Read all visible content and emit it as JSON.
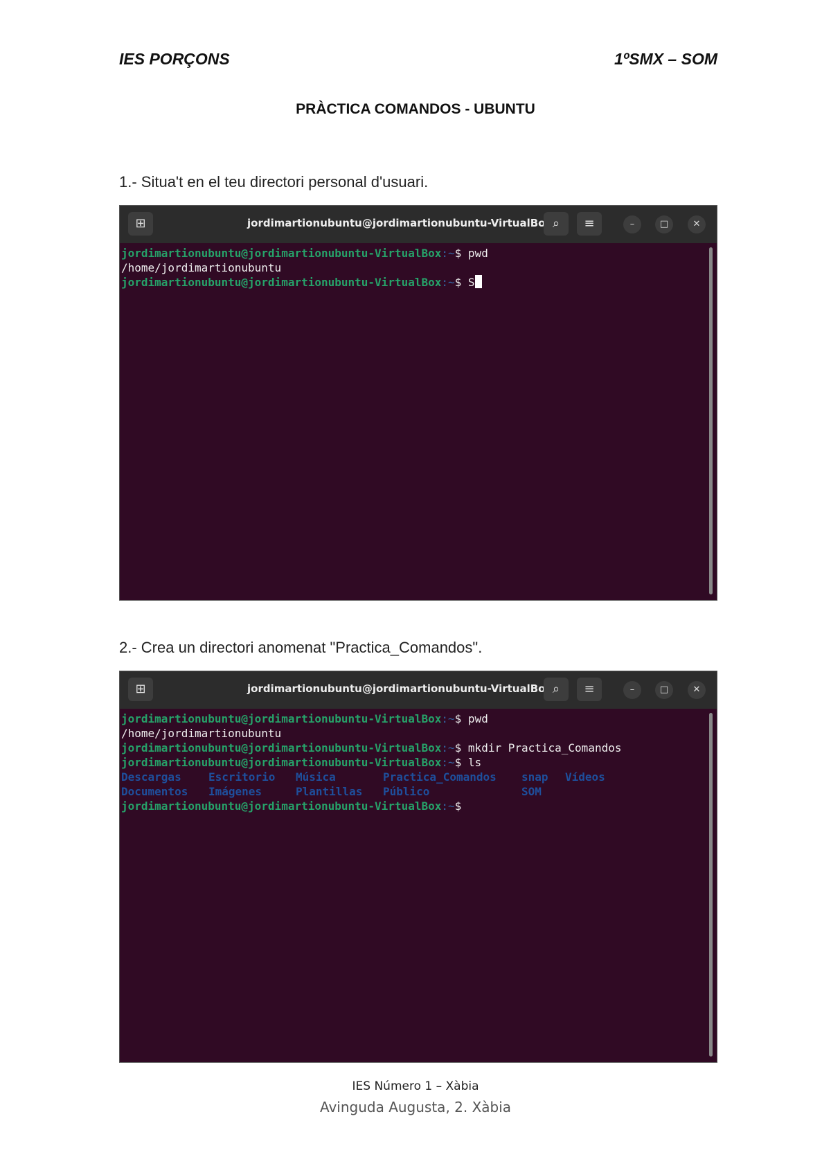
{
  "header": {
    "left": "IES PORÇONS",
    "right": "1ºSMX – SOM"
  },
  "title": "PRÀCTICA COMANDOS - UBUNTU",
  "questions": [
    "1.- Situa't en el teu directori personal d'usuari.",
    "2.- Crea un directori anomenat \"Practica_Comandos\"."
  ],
  "terminal": {
    "title": "jordimartionubuntu@jordimartionubuntu-VirtualBox: ~",
    "prompt_user": "jordimartionubuntu@jordimartionubuntu-VirtualBox",
    "prompt_path": ":~",
    "prompt_sym": "$",
    "cmd_pwd": "pwd",
    "pwd_output": "/home/jordimartionubuntu",
    "cmd_mkdir": "mkdir Practica_Comandos",
    "cmd_ls": "ls",
    "cursor_char": "S",
    "ls_row1": [
      "Descargas",
      "Escritorio",
      "Música",
      "Practica_Comandos",
      "snap",
      "Vídeos"
    ],
    "ls_row2": [
      "Documentos",
      "Imágenes",
      "Plantillas",
      "Público",
      "SOM"
    ]
  },
  "footer": {
    "line1": "IES Número 1 – Xàbia",
    "line2": "Avinguda Augusta, 2. Xàbia"
  }
}
